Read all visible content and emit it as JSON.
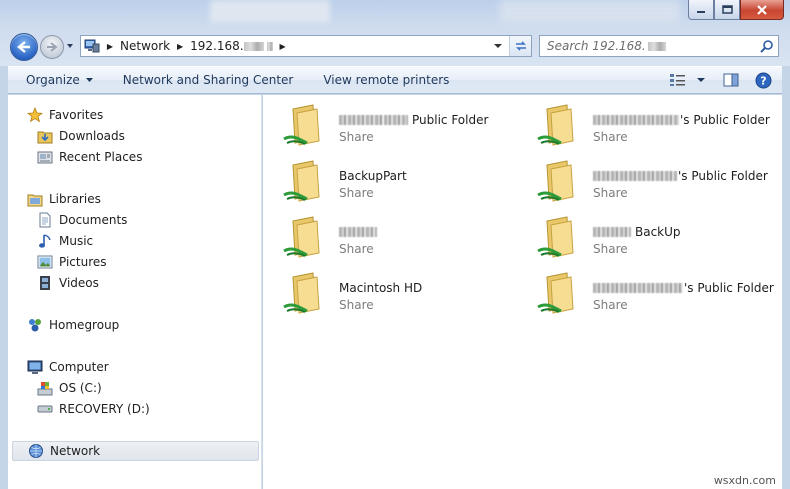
{
  "address_bar": {
    "crumbs": [
      "Network",
      "192.168."
    ]
  },
  "search": {
    "placeholder": "Search 192.168."
  },
  "toolbar": {
    "organize": "Organize",
    "network_sharing": "Network and Sharing Center",
    "remote_printers": "View remote printers"
  },
  "nav": {
    "favorites": "Favorites",
    "downloads": "Downloads",
    "recent": "Recent Places",
    "libraries": "Libraries",
    "documents": "Documents",
    "music": "Music",
    "pictures": "Pictures",
    "videos": "Videos",
    "homegroup": "Homegroup",
    "computer": "Computer",
    "os": "OS (C:)",
    "recovery": "RECOVERY (D:)",
    "network": "Network"
  },
  "shares": [
    {
      "name": "Public Folder",
      "type": "Share"
    },
    {
      "name": "BackupPart",
      "type": "Share"
    },
    {
      "name": "",
      "type": "Share"
    },
    {
      "name": "Macintosh HD",
      "type": "Share"
    },
    {
      "name": "'s Public Folder",
      "type": "Share"
    },
    {
      "name": "'s Public Folder",
      "type": "Share"
    },
    {
      "name": "BackUp",
      "type": "Share"
    },
    {
      "name": "'s Public Folder",
      "type": "Share"
    }
  ],
  "watermark": "wsxdn.com",
  "colors": {
    "accent": "#1e395b",
    "selection": "#dfe5ec",
    "frame": "#c5d5e8"
  }
}
